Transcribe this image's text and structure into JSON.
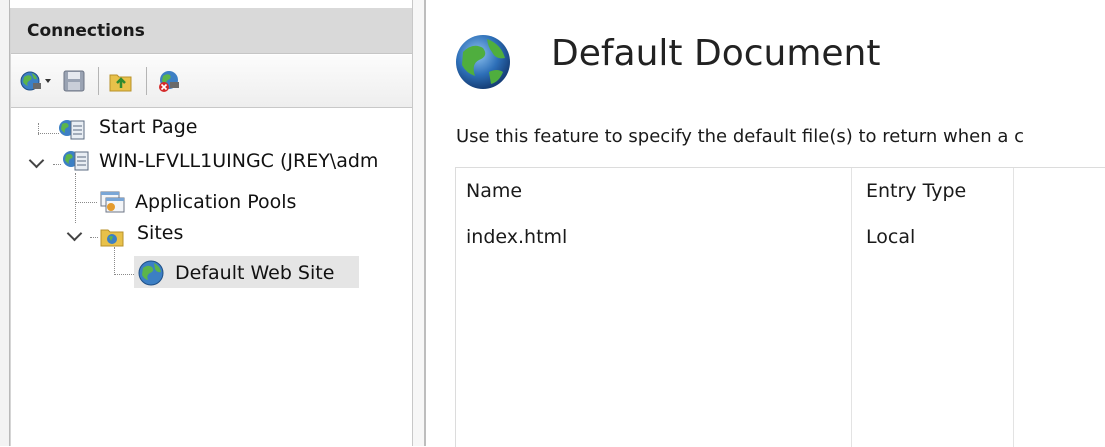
{
  "connections": {
    "title": "Connections",
    "toolbar": {
      "items": [
        {
          "name": "connect-icon"
        },
        {
          "name": "save-icon"
        },
        {
          "name": "up-folder-icon"
        },
        {
          "name": "disconnect-icon"
        }
      ]
    },
    "tree": {
      "start_page": "Start Page",
      "server": "WIN-LFVLL1UINGC (JREY\\adm",
      "app_pools": "Application Pools",
      "sites": "Sites",
      "default_site": "Default Web Site"
    }
  },
  "feature": {
    "title": "Default Document",
    "description": "Use this feature to specify the default file(s) to return when a c",
    "columns": [
      "Name",
      "Entry Type"
    ],
    "rows": [
      {
        "name": "index.html",
        "entry_type": "Local"
      }
    ]
  },
  "colors": {
    "header_bg": "#d9d9d9",
    "selected_bg": "#e5e5e5"
  }
}
